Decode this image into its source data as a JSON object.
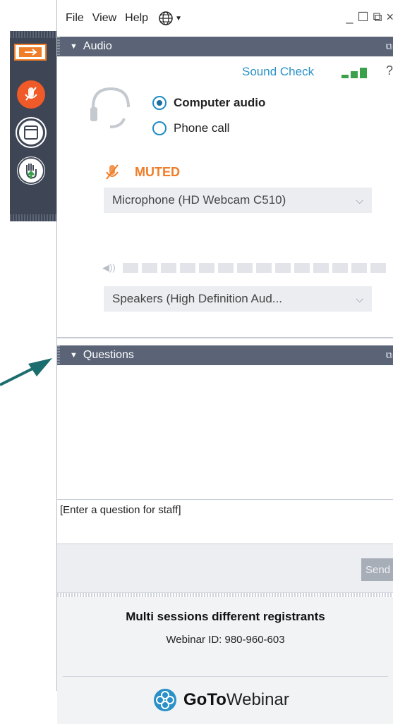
{
  "menu": {
    "file": "File",
    "view": "View",
    "help": "Help"
  },
  "window_controls": {
    "minimize": "_",
    "maximize": "☐",
    "popout": "⧉",
    "close": "×"
  },
  "audio_panel": {
    "title": "Audio",
    "sound_check": "Sound Check",
    "help": "?",
    "options": {
      "computer": "Computer audio",
      "phone": "Phone call",
      "selected": "computer"
    },
    "muted_label": "MUTED",
    "microphone": "Microphone (HD Webcam C510)",
    "speakers": "Speakers (High Definition Aud...",
    "colors": {
      "muted": "#f07d28",
      "link": "#2a91c8",
      "header": "#5a6476"
    }
  },
  "questions_panel": {
    "title": "Questions",
    "input_placeholder": "[Enter a question for staff]",
    "send_label": "Send"
  },
  "footer": {
    "session_title": "Multi sessions different registrants",
    "webinar_id": "Webinar ID: 980-960-603",
    "logo_goto": "GoTo",
    "logo_webinar": "Webinar"
  }
}
